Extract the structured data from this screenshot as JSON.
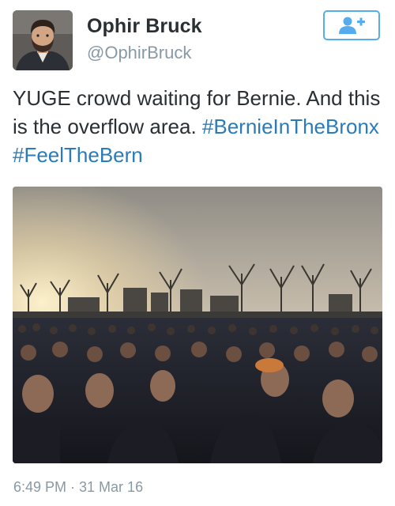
{
  "user": {
    "display_name": "Ophir Bruck",
    "screen_name": "@OphirBruck",
    "avatar_icon": "profile-photo"
  },
  "follow_button": {
    "icon": "follow-user-plus-icon",
    "accent_color": "#55acee"
  },
  "tweet": {
    "text": "YUGE crowd waiting for Bernie. And this is the overflow area.",
    "hashtags": [
      "#BernieInTheBronx",
      "#FeelTheBern"
    ],
    "hashtag_color": "#2b7bb9"
  },
  "media": {
    "type": "photo"
  },
  "timestamp": "6:49 PM · 31 Mar 16"
}
